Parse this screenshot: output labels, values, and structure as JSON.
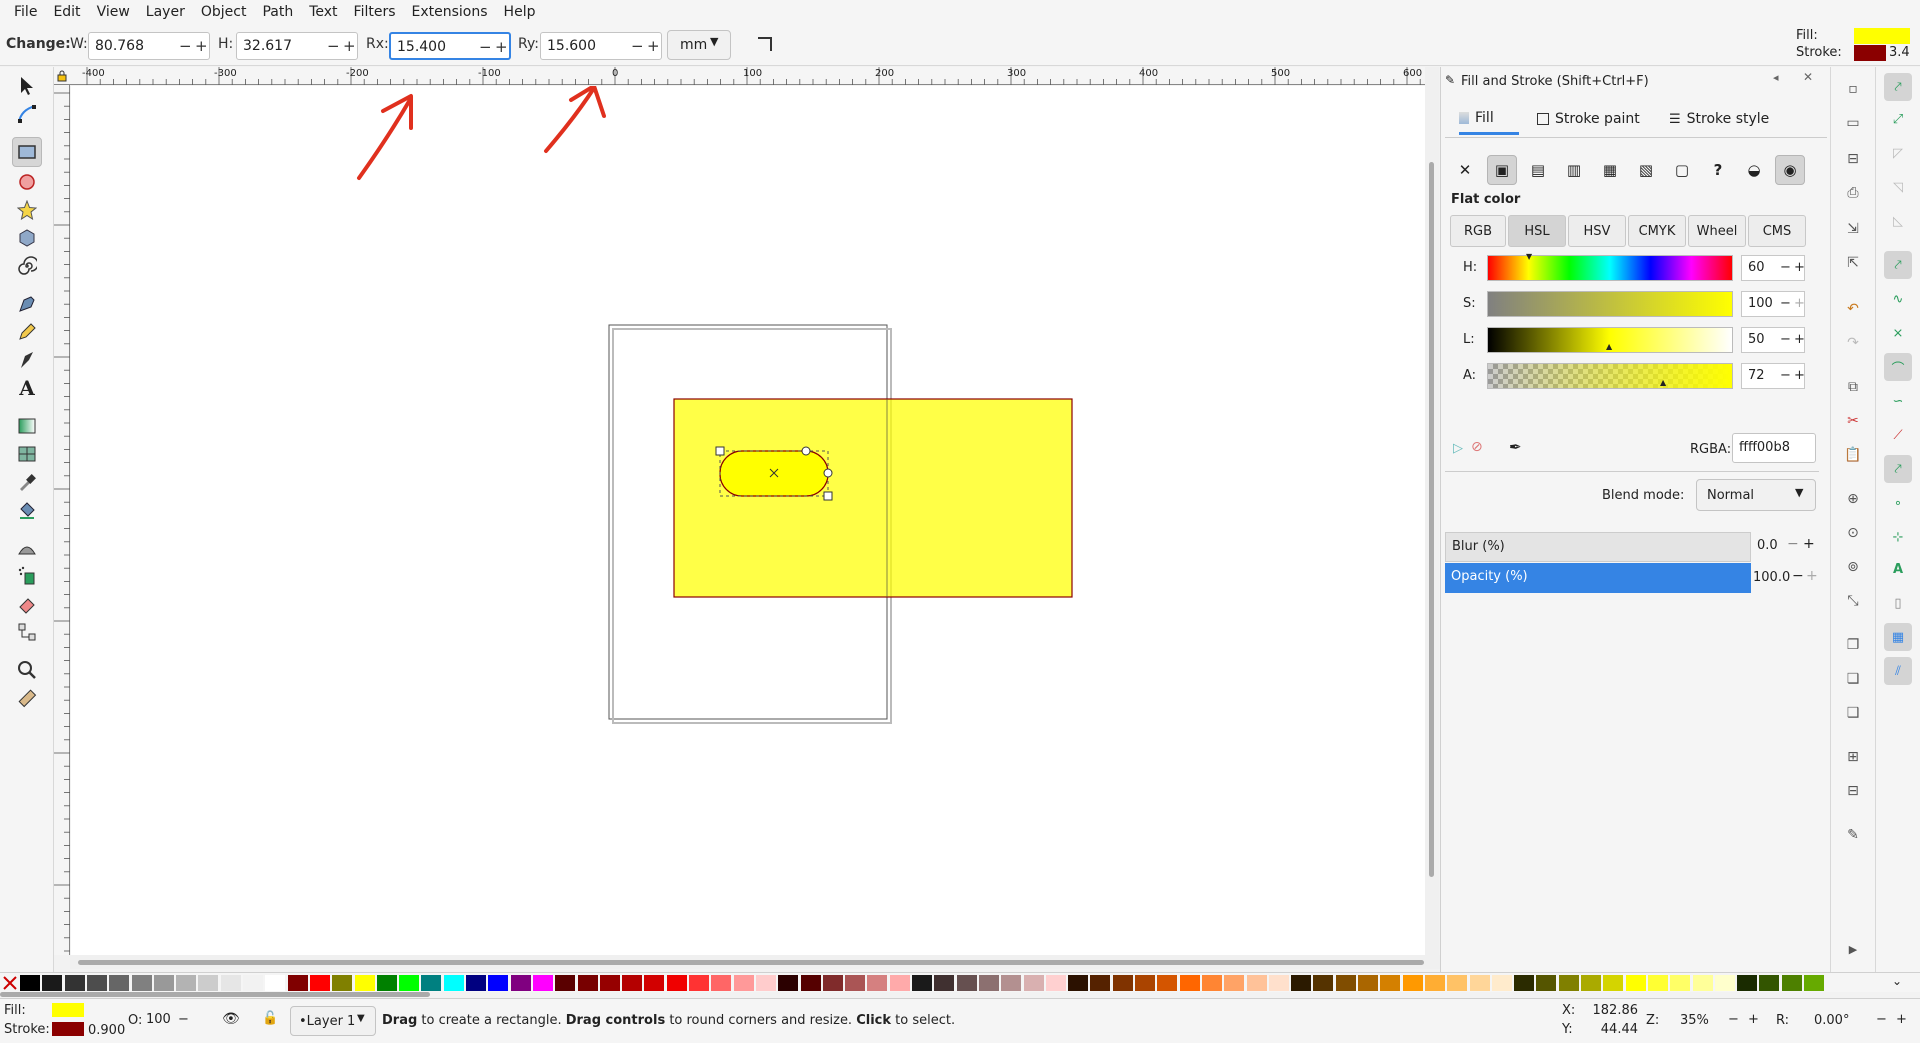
{
  "menu": [
    "File",
    "Edit",
    "View",
    "Layer",
    "Object",
    "Path",
    "Text",
    "Filters",
    "Extensions",
    "Help"
  ],
  "toolbar": {
    "change_label": "Change:",
    "w_label": "W:",
    "w_value": "80.768",
    "h_label": "H:",
    "h_value": "32.617",
    "rx_label": "Rx:",
    "rx_value": "15.400",
    "ry_label": "Ry:",
    "ry_value": "15.600",
    "unit": "mm",
    "minus": "−",
    "plus": "+"
  },
  "indicator": {
    "fill_label": "Fill:",
    "stroke_label": "Stroke:",
    "stroke_width": "3.4",
    "fill_color": "#ffff00",
    "stroke_color": "#8b0000"
  },
  "ruler": {
    "h_ticks": [
      "-400",
      "-300",
      "-200",
      "-100",
      "0",
      "100",
      "200",
      "300",
      "400",
      "500",
      "600"
    ],
    "v_ticks": [
      "0",
      "100",
      "200",
      "300",
      "400",
      "500",
      "600",
      "700",
      "800",
      "900"
    ]
  },
  "dialog": {
    "title": "Fill and Stroke (Shift+Ctrl+F)",
    "tabs": [
      "Fill",
      "Stroke paint",
      "Stroke style"
    ],
    "paint_buttons": [
      "✕",
      "▣",
      "▤",
      "▥",
      "▦",
      "▧",
      "▢",
      "?",
      "◒",
      "◉"
    ],
    "flat_color": "Flat color",
    "modes": [
      "RGB",
      "HSL",
      "HSV",
      "CMYK",
      "Wheel",
      "CMS"
    ],
    "sliders": [
      {
        "label": "H:",
        "value": "60"
      },
      {
        "label": "S:",
        "value": "100"
      },
      {
        "label": "L:",
        "value": "50"
      },
      {
        "label": "A:",
        "value": "72"
      }
    ],
    "rgba_label": "RGBA:",
    "rgba_value": "ffff00b8",
    "blend_label": "Blend mode:",
    "blend_value": "Normal",
    "blur_label": "Blur (%)",
    "blur_value": "0.0",
    "opacity_label": "Opacity (%)",
    "opacity_value": "100.0"
  },
  "status": {
    "fill_label": "Fill:",
    "stroke_label": "Stroke:",
    "stroke_width": "0.900",
    "o_label": "O:",
    "o_value": "100",
    "layer": "•Layer 1",
    "msg_drag1": "Drag",
    "msg_1": " to create a rectangle. ",
    "msg_drag2": "Drag controls",
    "msg_2": " to round corners and resize. ",
    "msg_click": "Click",
    "msg_3": " to select.",
    "x_label": "X:",
    "x_value": "182.86",
    "y_label": "Y:",
    "y_value": "44.44",
    "z_label": "Z:",
    "zoom": "35%",
    "r_label": "R:",
    "rotation": "0.00°"
  },
  "colors": {
    "accent": "#3584e4",
    "fill": "#ffff00",
    "stroke": "#8b0000",
    "annotation": "#e0301e"
  },
  "palette": [
    "#000000",
    "#1a1a1a",
    "#333333",
    "#4d4d4d",
    "#666666",
    "#808080",
    "#999999",
    "#b3b3b3",
    "#cccccc",
    "#e6e6e6",
    "#f2f2f2",
    "#ffffff",
    "#800000",
    "#ff0000",
    "#808000",
    "#ffff00",
    "#008000",
    "#00ff00",
    "#008080",
    "#00ffff",
    "#000080",
    "#0000ff",
    "#800080",
    "#ff00ff",
    "#5a0000",
    "#780000",
    "#960000",
    "#b40000",
    "#d20000",
    "#f00000",
    "#ff3333",
    "#ff6666",
    "#ff9999",
    "#ffcccc",
    "#2b0000",
    "#550000",
    "#802b2b",
    "#aa5555",
    "#d58080",
    "#ffaaaa",
    "#1a1a1a",
    "#403030",
    "#665050",
    "#8c7070",
    "#b39090",
    "#d9b0b0",
    "#ffd0d0",
    "#2b1100",
    "#552200",
    "#803300",
    "#aa4400",
    "#d45500",
    "#ff6600",
    "#ff8533",
    "#ffa366",
    "#ffc299",
    "#ffe0cc",
    "#2b1a00",
    "#553300",
    "#804d00",
    "#aa6600",
    "#d48000",
    "#ff9900",
    "#ffad33",
    "#ffc266",
    "#ffd699",
    "#ffebcc",
    "#2b2b00",
    "#555500",
    "#808000",
    "#aaaa00",
    "#d4d400",
    "#ffff00",
    "#ffff33",
    "#ffff66",
    "#ffff99",
    "#ffffcc",
    "#1a2b00",
    "#335500",
    "#4d8000",
    "#66aa00"
  ]
}
